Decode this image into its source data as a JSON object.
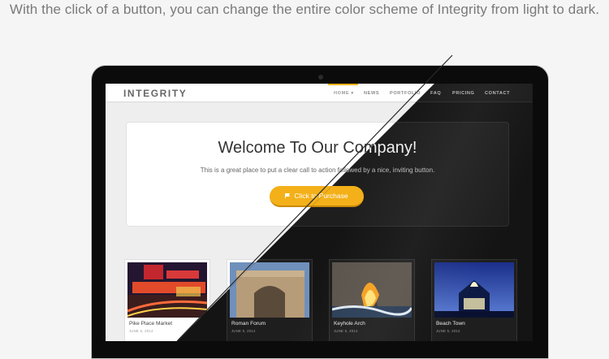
{
  "caption": "With the click of a button, you can change the entire color scheme of Integrity from light to dark.",
  "site": {
    "logo": "INTEGRITY",
    "nav": [
      "HOME ▾",
      "NEWS",
      "PORTFOLIO",
      "FAQ",
      "PRICING",
      "CONTACT"
    ],
    "hero": {
      "title": "Welcome To Our Company!",
      "subtitle": "This is a great place to put a clear call to action followed by a nice, inviting button.",
      "button": "Click to Purchase"
    },
    "portfolio": [
      {
        "title": "Pike Place Market",
        "date": "JUNE 6, 2014"
      },
      {
        "title": "Roman Forum",
        "date": "JUNE 5, 2014"
      },
      {
        "title": "Keyhole Arch",
        "date": "JUNE 5, 2014"
      },
      {
        "title": "Beach Town",
        "date": "JUNE 5, 2014"
      }
    ]
  },
  "colors": {
    "accent": "#f3b019",
    "light_bg": "#eeeeee",
    "dark_bg": "#141414"
  },
  "icons": {
    "cta": "flag-icon",
    "camera": "webcam-icon"
  }
}
